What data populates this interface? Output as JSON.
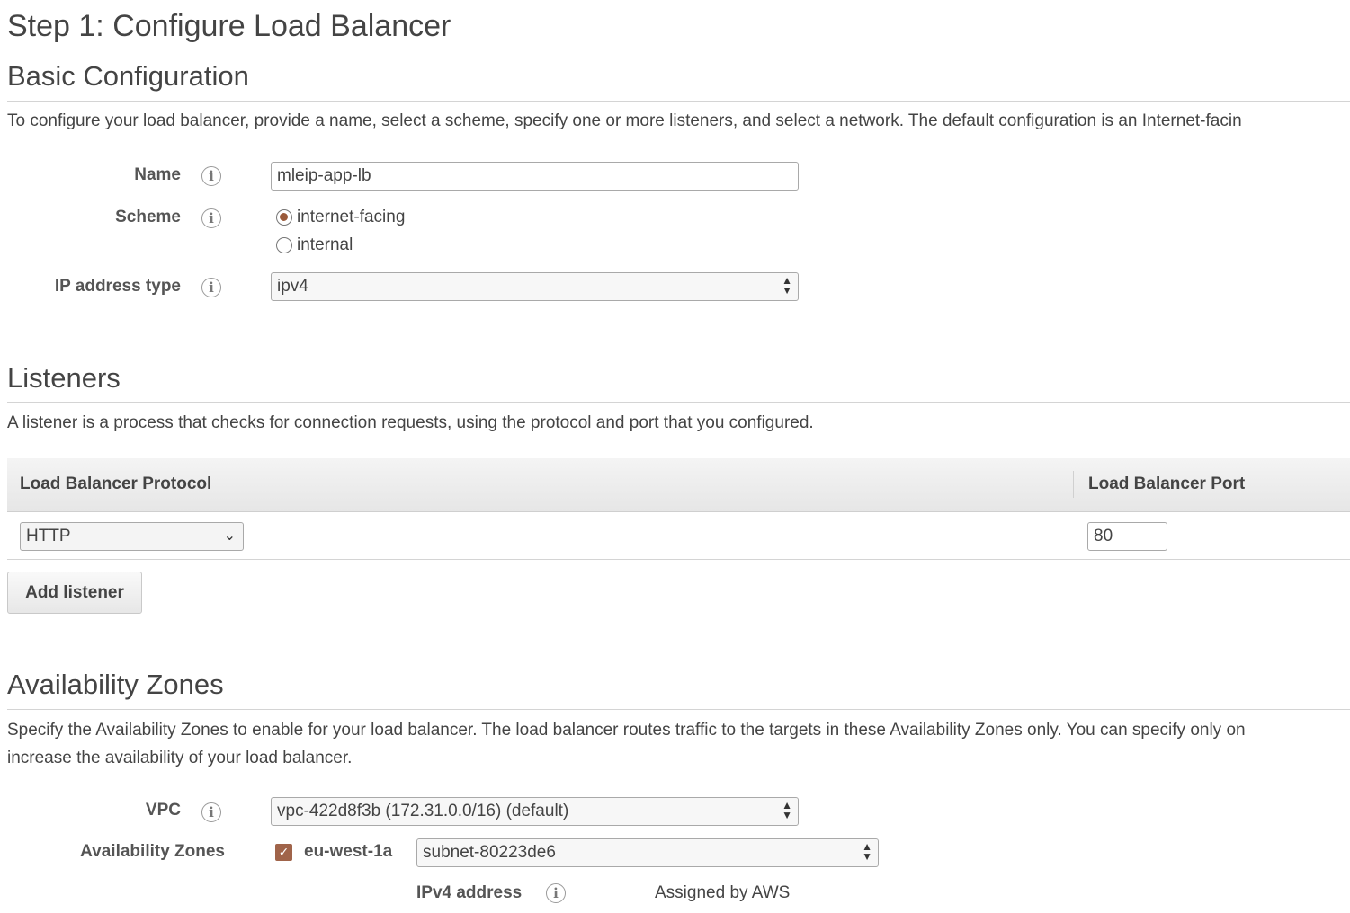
{
  "page_title": "Step 1: Configure Load Balancer",
  "basic": {
    "heading": "Basic Configuration",
    "description": "To configure your load balancer, provide a name, select a scheme, specify one or more listeners, and select a network. The default configuration is an Internet-facin",
    "name_label": "Name",
    "name_value": "mleip-app-lb",
    "scheme_label": "Scheme",
    "scheme_options": [
      "internet-facing",
      "internal"
    ],
    "scheme_selected": "internet-facing",
    "ip_type_label": "IP address type",
    "ip_type_value": "ipv4"
  },
  "listeners": {
    "heading": "Listeners",
    "description": "A listener is a process that checks for connection requests, using the protocol and port that you configured.",
    "col_protocol": "Load Balancer Protocol",
    "col_port": "Load Balancer Port",
    "row_protocol": "HTTP",
    "row_port": "80",
    "add_button": "Add listener"
  },
  "az": {
    "heading": "Availability Zones",
    "description_line1": "Specify the Availability Zones to enable for your load balancer. The load balancer routes traffic to the targets in these Availability Zones only. You can specify only on",
    "description_line2": "increase the availability of your load balancer.",
    "vpc_label": "VPC",
    "vpc_value": "vpc-422d8f3b (172.31.0.0/16) (default)",
    "zones_label": "Availability Zones",
    "zone_name": "eu-west-1a",
    "zone_checked": true,
    "subnet_value": "subnet-80223de6",
    "ipv4_label": "IPv4 address",
    "ipv4_value": "Assigned by AWS"
  },
  "icons": {
    "info": "info-icon",
    "select_arrows": "updown-arrows-icon",
    "dropdown": "chevron-down-icon",
    "checkbox": "checkmark-icon"
  },
  "colors": {
    "accent": "#a0644a",
    "heading": "#444444",
    "rule": "#d4d4d4"
  }
}
